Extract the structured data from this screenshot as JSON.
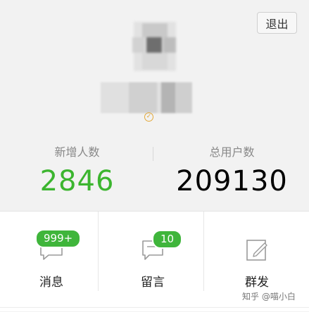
{
  "header": {
    "logout_label": "退出"
  },
  "stats": {
    "new_users_label": "新增人数",
    "new_users_value": "2846",
    "total_users_label": "总用户数",
    "total_users_value": "209130"
  },
  "menu": [
    {
      "label": "消息",
      "badge": "999+",
      "icon": "message-icon"
    },
    {
      "label": "留言",
      "badge": "10",
      "icon": "comment-icon"
    },
    {
      "label": "群发",
      "badge": "",
      "icon": "compose-icon"
    }
  ],
  "watermark": "知乎 @喵小白",
  "colors": {
    "accent_green": "#3cb52f",
    "badge_green": "#3fb53b"
  }
}
